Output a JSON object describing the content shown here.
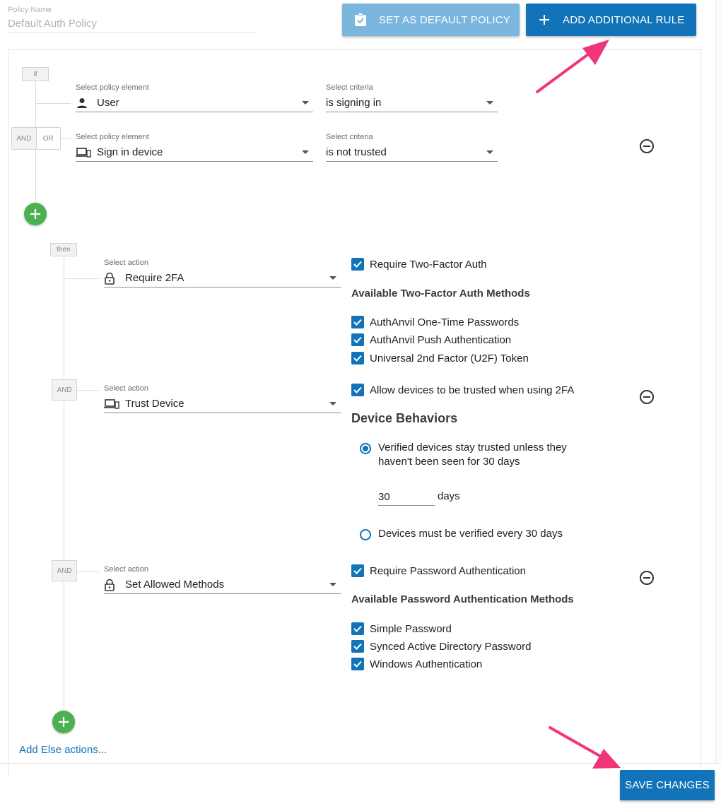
{
  "policy": {
    "name_label": "Policy Name",
    "name_value": "Default Auth Policy"
  },
  "toolbar": {
    "set_default_label": "SET AS DEFAULT POLICY",
    "add_rule_label": "ADD ADDITIONAL RULE",
    "save_label": "SAVE CHANGES"
  },
  "conditions": {
    "if_tag": "if",
    "and_label": "AND",
    "or_label": "OR",
    "rows": [
      {
        "element_label": "Select policy element",
        "element_value": "User",
        "element_icon": "person-icon",
        "criteria_label": "Select criteria",
        "criteria_value": "is signing in"
      },
      {
        "element_label": "Select policy element",
        "element_value": "Sign in device",
        "element_icon": "device-icon",
        "criteria_label": "Select criteria",
        "criteria_value": "is not trusted"
      }
    ]
  },
  "actions": {
    "then_tag": "then",
    "and_tag": "AND",
    "action_label": "Select action",
    "items": [
      {
        "value": "Require 2FA",
        "icon": "lock-icon",
        "main_check": "Require Two-Factor Auth",
        "heading": "Available Two-Factor Auth Methods",
        "options": [
          "AuthAnvil One-Time Passwords",
          "AuthAnvil Push Authentication",
          "Universal 2nd Factor (U2F) Token"
        ]
      },
      {
        "value": "Trust Device",
        "icon": "device-icon",
        "main_check": "Allow devices to be trusted when using 2FA",
        "heading": "Device Behaviors",
        "radio1_line1": "Verified devices stay trusted unless they",
        "radio1_line2": "haven't been seen for 30 days",
        "days_value": "30",
        "days_unit": "days",
        "radio2": "Devices must be verified every 30 days"
      },
      {
        "value": "Set Allowed Methods",
        "icon": "lock-icon",
        "main_check": "Require Password Authentication",
        "heading": "Available Password Authentication Methods",
        "options": [
          "Simple Password",
          "Synced Active Directory Password",
          "Windows Authentication"
        ]
      }
    ],
    "else_link": "Add Else actions..."
  },
  "colors": {
    "primary": "#1273b8",
    "primary_light": "#7ab6de",
    "success": "#4caf50",
    "arrow": "#f0357a"
  }
}
